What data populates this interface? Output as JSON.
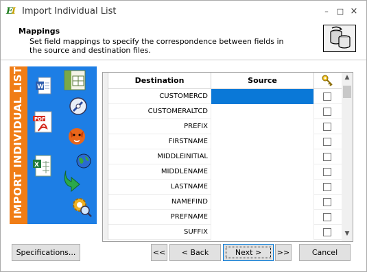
{
  "window": {
    "title": "Import Individual List",
    "app_icon_text": "EI",
    "controls": {
      "minimize": "–",
      "maximize": "□",
      "close": "×"
    }
  },
  "header": {
    "title": "Mappings",
    "description": "Set field mappings to specify the correspondence between fields in the source and destination files."
  },
  "sidebar": {
    "vertical_text": "IMPORT INDIVIDUAL LIST",
    "icons": [
      "word-document-icon",
      "spreadsheet-icon",
      "pdf-icon",
      "globe-compass-icon",
      "firefox-icon",
      "excel-icon",
      "earth-icon",
      "green-arrow-icon",
      "gear-search-icon"
    ]
  },
  "grid": {
    "columns": {
      "destination": "Destination",
      "source": "Source",
      "key": "key-icon"
    },
    "rows": [
      {
        "destination": "CUSTOMERCD",
        "source": "",
        "selected": true,
        "checked": false
      },
      {
        "destination": "CUSTOMERALTCD",
        "source": "",
        "selected": false,
        "checked": false
      },
      {
        "destination": "PREFIX",
        "source": "",
        "selected": false,
        "checked": false
      },
      {
        "destination": "FIRSTNAME",
        "source": "",
        "selected": false,
        "checked": false
      },
      {
        "destination": "MIDDLEINITIAL",
        "source": "",
        "selected": false,
        "checked": false
      },
      {
        "destination": "MIDDLENAME",
        "source": "",
        "selected": false,
        "checked": false
      },
      {
        "destination": "LASTNAME",
        "source": "",
        "selected": false,
        "checked": false
      },
      {
        "destination": "NAMEFIND",
        "source": "",
        "selected": false,
        "checked": false
      },
      {
        "destination": "PREFNAME",
        "source": "",
        "selected": false,
        "checked": false
      },
      {
        "destination": "SUFFIX",
        "source": "",
        "selected": false,
        "checked": false
      }
    ]
  },
  "buttons": {
    "specifications": "Specifications...",
    "first": "<<",
    "back": "< Back",
    "next": "Next >",
    "last": ">>",
    "cancel": "Cancel"
  },
  "colors": {
    "sidebar_blue": "#1d7ee5",
    "sidebar_orange": "#f07d16",
    "selection": "#0a78d7"
  }
}
